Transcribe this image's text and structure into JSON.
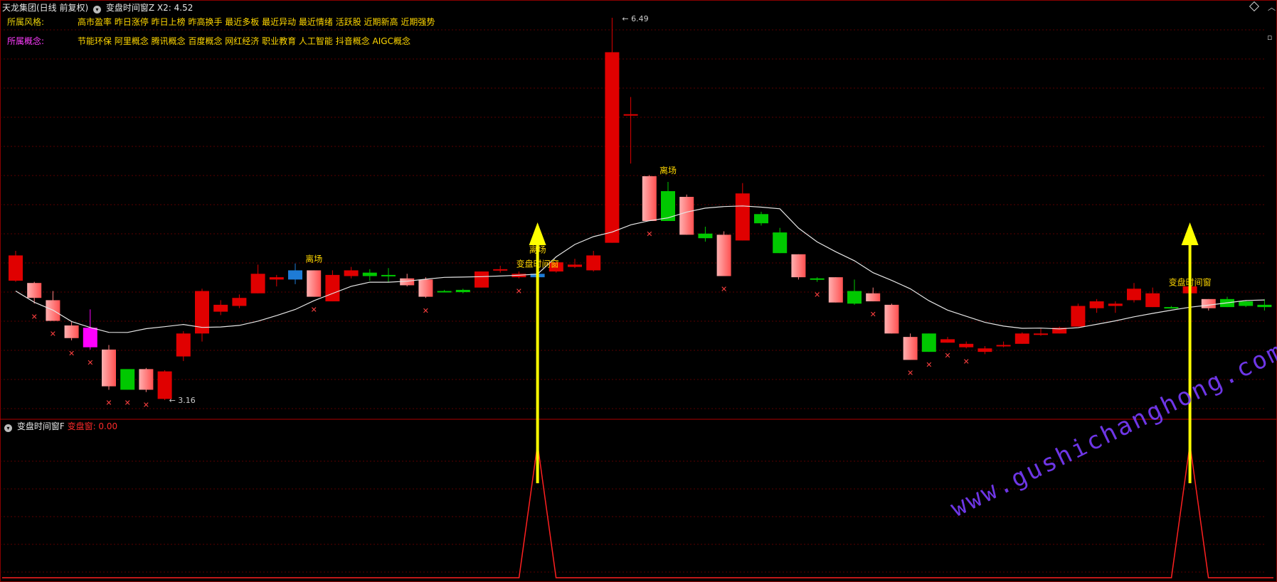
{
  "header": {
    "stock_title": "天龙集团(日线 前复权)",
    "indicator_name": "变盘时间窗Z",
    "indicator_value": "X2: 4.52",
    "style_label": "所属风格:",
    "style_items": "高市盈率 昨日涨停 昨日上榜 昨高换手 最近多板 最近异动 最近情绪 活跃股 近期新高 近期强势",
    "concept_label": "所属概念:",
    "concept_items": "节能环保 阿里概念 腾讯概念 百度概念 网红经济 职业教育 人工智能 抖音概念 AIGC概念"
  },
  "price_panel": {
    "high_marker": "6.49",
    "low_marker": "3.16",
    "annotations": [
      {
        "text": "离场",
        "bar": 16
      },
      {
        "text": "离场",
        "bar": 28
      },
      {
        "text": "变盘时间窗",
        "bar": 28
      },
      {
        "text": "离场",
        "bar": 35
      },
      {
        "text": "变盘时间窗",
        "bar": 63
      }
    ]
  },
  "indicator_panel": {
    "title": "变盘时间窗F",
    "value_text": "变盘窗: 0.00"
  },
  "watermark": "www.gushichanghong.com",
  "colors": {
    "up": "#e00000",
    "down": "#00c800",
    "light_up": "#ff8080",
    "magenta": "#ff00ff",
    "blue": "#1e7bd6",
    "grid": "#5a0000",
    "ma": "#e6e6e6",
    "signal": "#ffff00",
    "window_line": "#ff2020"
  },
  "chart_data": {
    "type": "candlestick",
    "price_range": [
      3.16,
      6.49
    ],
    "candles": [
      {
        "o": 4.2,
        "h": 4.46,
        "l": 4.19,
        "c": 4.42,
        "color": "red"
      },
      {
        "o": 4.05,
        "h": 4.19,
        "l": 4.0,
        "c": 4.18,
        "color": "lightred"
      },
      {
        "o": 3.85,
        "h": 4.11,
        "l": 3.85,
        "c": 4.03,
        "color": "lightred"
      },
      {
        "o": 3.7,
        "h": 3.84,
        "l": 3.68,
        "c": 3.81,
        "color": "lightred"
      },
      {
        "o": 3.79,
        "h": 3.95,
        "l": 3.6,
        "c": 3.62,
        "color": "magenta"
      },
      {
        "o": 3.28,
        "h": 3.64,
        "l": 3.25,
        "c": 3.6,
        "color": "lightred"
      },
      {
        "o": 3.43,
        "h": 3.41,
        "l": 3.25,
        "c": 3.25,
        "color": "green"
      },
      {
        "o": 3.25,
        "h": 3.44,
        "l": 3.23,
        "c": 3.43,
        "color": "lightred"
      },
      {
        "o": 3.17,
        "h": 3.42,
        "l": 3.16,
        "c": 3.41,
        "color": "red"
      },
      {
        "o": 3.54,
        "h": 3.76,
        "l": 3.5,
        "c": 3.74,
        "color": "red"
      },
      {
        "o": 3.74,
        "h": 4.13,
        "l": 3.67,
        "c": 4.11,
        "color": "red"
      },
      {
        "o": 3.93,
        "h": 4.03,
        "l": 3.9,
        "c": 3.99,
        "color": "red"
      },
      {
        "o": 3.98,
        "h": 4.08,
        "l": 3.96,
        "c": 4.05,
        "color": "red"
      },
      {
        "o": 4.26,
        "h": 4.34,
        "l": 4.09,
        "c": 4.09,
        "color": "red"
      },
      {
        "o": 4.21,
        "h": 4.25,
        "l": 4.15,
        "c": 4.23,
        "color": "red"
      },
      {
        "o": 4.29,
        "h": 4.35,
        "l": 4.17,
        "c": 4.21,
        "color": "blue"
      },
      {
        "o": 4.06,
        "h": 4.29,
        "l": 4.06,
        "c": 4.29,
        "color": "lightred"
      },
      {
        "o": 4.02,
        "h": 4.29,
        "l": 4.02,
        "c": 4.25,
        "color": "red"
      },
      {
        "o": 4.24,
        "h": 4.32,
        "l": 4.22,
        "c": 4.29,
        "color": "red"
      },
      {
        "o": 4.27,
        "h": 4.3,
        "l": 4.2,
        "c": 4.24,
        "color": "green"
      },
      {
        "o": 4.25,
        "h": 4.31,
        "l": 4.19,
        "c": 4.25,
        "color": "green"
      },
      {
        "o": 4.16,
        "h": 4.26,
        "l": 4.15,
        "c": 4.22,
        "color": "lightred"
      },
      {
        "o": 4.06,
        "h": 4.23,
        "l": 4.05,
        "c": 4.21,
        "color": "lightred"
      },
      {
        "o": 4.11,
        "h": 4.12,
        "l": 4.1,
        "c": 4.11,
        "color": "green"
      },
      {
        "o": 4.12,
        "h": 4.13,
        "l": 4.09,
        "c": 4.1,
        "color": "green"
      },
      {
        "o": 4.14,
        "h": 4.28,
        "l": 4.14,
        "c": 4.28,
        "color": "red"
      },
      {
        "o": 4.29,
        "h": 4.33,
        "l": 4.27,
        "c": 4.3,
        "color": "red"
      },
      {
        "o": 4.23,
        "h": 4.28,
        "l": 4.22,
        "c": 4.26,
        "color": "red"
      },
      {
        "o": 4.23,
        "h": 4.37,
        "l": 4.03,
        "c": 4.26,
        "color": "blue"
      },
      {
        "o": 4.28,
        "h": 4.37,
        "l": 4.27,
        "c": 4.36,
        "color": "red"
      },
      {
        "o": 4.32,
        "h": 4.39,
        "l": 4.31,
        "c": 4.34,
        "color": "red"
      },
      {
        "o": 4.29,
        "h": 4.46,
        "l": 4.28,
        "c": 4.42,
        "color": "red"
      },
      {
        "o": 4.53,
        "h": 6.49,
        "l": 4.53,
        "c": 6.19,
        "color": "red"
      },
      {
        "o": 5.65,
        "h": 5.8,
        "l": 5.22,
        "c": 5.65,
        "color": "red"
      },
      {
        "o": 4.72,
        "h": 5.12,
        "l": 4.72,
        "c": 5.11,
        "color": "lightred"
      },
      {
        "o": 4.98,
        "h": 5.06,
        "l": 4.9,
        "c": 4.72,
        "color": "green"
      },
      {
        "o": 4.6,
        "h": 4.95,
        "l": 4.6,
        "c": 4.93,
        "color": "lightred"
      },
      {
        "o": 4.61,
        "h": 4.67,
        "l": 4.54,
        "c": 4.57,
        "color": "green"
      },
      {
        "o": 4.24,
        "h": 4.63,
        "l": 4.24,
        "c": 4.6,
        "color": "lightred"
      },
      {
        "o": 4.55,
        "h": 5.05,
        "l": 4.55,
        "c": 4.96,
        "color": "red"
      },
      {
        "o": 4.78,
        "h": 4.8,
        "l": 4.68,
        "c": 4.7,
        "color": "green"
      },
      {
        "o": 4.62,
        "h": 4.66,
        "l": 4.44,
        "c": 4.44,
        "color": "green"
      },
      {
        "o": 4.23,
        "h": 4.43,
        "l": 4.21,
        "c": 4.43,
        "color": "lightred"
      },
      {
        "o": 4.22,
        "h": 4.23,
        "l": 4.19,
        "c": 4.21,
        "color": "green"
      },
      {
        "o": 4.01,
        "h": 4.23,
        "l": 4.01,
        "c": 4.23,
        "color": "lightred"
      },
      {
        "o": 4.11,
        "h": 4.21,
        "l": 3.99,
        "c": 4.0,
        "color": "green"
      },
      {
        "o": 4.02,
        "h": 4.14,
        "l": 4.02,
        "c": 4.09,
        "color": "lightred"
      },
      {
        "o": 3.74,
        "h": 4.0,
        "l": 3.74,
        "c": 3.99,
        "color": "lightred"
      },
      {
        "o": 3.51,
        "h": 3.74,
        "l": 3.51,
        "c": 3.71,
        "color": "lightred"
      },
      {
        "o": 3.74,
        "h": 3.74,
        "l": 3.58,
        "c": 3.58,
        "color": "green"
      },
      {
        "o": 3.66,
        "h": 3.71,
        "l": 3.66,
        "c": 3.69,
        "color": "red"
      },
      {
        "o": 3.62,
        "h": 3.67,
        "l": 3.61,
        "c": 3.65,
        "color": "red"
      },
      {
        "o": 3.58,
        "h": 3.63,
        "l": 3.56,
        "c": 3.61,
        "color": "red"
      },
      {
        "o": 3.64,
        "h": 3.67,
        "l": 3.62,
        "c": 3.64,
        "color": "red"
      },
      {
        "o": 3.65,
        "h": 3.75,
        "l": 3.65,
        "c": 3.74,
        "color": "red"
      },
      {
        "o": 3.74,
        "h": 3.78,
        "l": 3.72,
        "c": 3.74,
        "color": "red"
      },
      {
        "o": 3.74,
        "h": 3.8,
        "l": 3.74,
        "c": 3.79,
        "color": "red"
      },
      {
        "o": 3.8,
        "h": 4.0,
        "l": 3.8,
        "c": 3.98,
        "color": "red"
      },
      {
        "o": 3.96,
        "h": 4.04,
        "l": 3.92,
        "c": 4.02,
        "color": "red"
      },
      {
        "o": 3.98,
        "h": 4.02,
        "l": 3.92,
        "c": 4.0,
        "color": "red"
      },
      {
        "o": 4.03,
        "h": 4.18,
        "l": 4.01,
        "c": 4.13,
        "color": "red"
      },
      {
        "o": 3.97,
        "h": 4.14,
        "l": 3.97,
        "c": 4.09,
        "color": "red"
      },
      {
        "o": 3.97,
        "h": 3.98,
        "l": 3.96,
        "c": 3.97,
        "color": "green"
      },
      {
        "o": 4.09,
        "h": 4.21,
        "l": 4.07,
        "c": 4.15,
        "color": "red"
      },
      {
        "o": 3.96,
        "h": 4.04,
        "l": 3.94,
        "c": 4.04,
        "color": "lightred"
      },
      {
        "o": 4.04,
        "h": 4.06,
        "l": 3.97,
        "c": 3.97,
        "color": "green"
      },
      {
        "o": 4.02,
        "h": 4.03,
        "l": 3.97,
        "c": 3.98,
        "color": "green"
      },
      {
        "o": 3.99,
        "h": 4.04,
        "l": 3.94,
        "c": 3.97,
        "color": "green"
      }
    ]
  }
}
